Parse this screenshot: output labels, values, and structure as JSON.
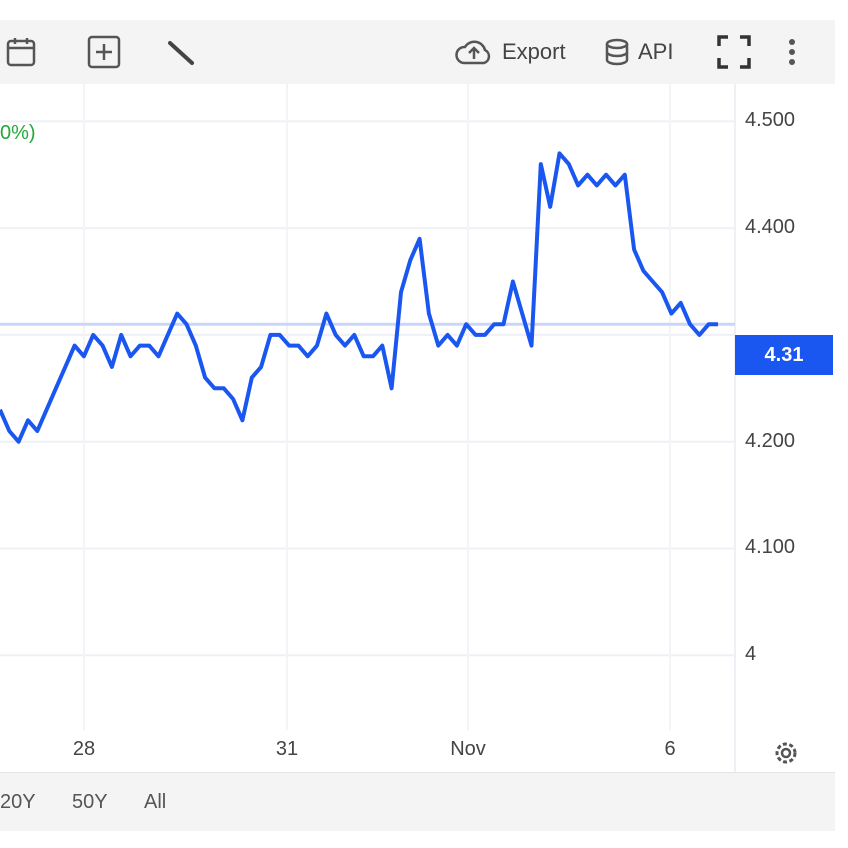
{
  "toolbar": {
    "export_label": "Export",
    "api_label": "API",
    "icons": [
      "calendar-icon",
      "add-indicator-icon",
      "draw-icon",
      "cloud-export-icon",
      "database-api-icon",
      "fullscreen-icon",
      "more-icon"
    ]
  },
  "legend": {
    "change_text": "0%)"
  },
  "last_price_label": "4.31",
  "range_buttons": [
    "20Y",
    "50Y",
    "All"
  ],
  "colors": {
    "line": "#1a56f0",
    "grid": "#eef0f5",
    "accent": "#1a56f0",
    "positive": "#22a83a"
  },
  "chart_data": {
    "type": "line",
    "ylim": [
      3.93,
      4.52
    ],
    "yticks": [
      4,
      4.1,
      4.2,
      4.3,
      4.4,
      4.5
    ],
    "ytick_labels": [
      "4",
      "4.100",
      "4.200",
      "",
      "4.400",
      "4.500"
    ],
    "xtick_labels": [
      "28",
      "31",
      "Nov",
      "6"
    ],
    "last_value": 4.31,
    "grid": true,
    "series": [
      {
        "values": [
          4.23,
          4.21,
          4.2,
          4.22,
          4.21,
          4.23,
          4.25,
          4.27,
          4.29,
          4.28,
          4.3,
          4.29,
          4.27,
          4.3,
          4.28,
          4.29,
          4.29,
          4.28,
          4.3,
          4.32,
          4.31,
          4.29,
          4.26,
          4.25,
          4.25,
          4.24,
          4.22,
          4.26,
          4.27,
          4.3,
          4.3,
          4.29,
          4.29,
          4.28,
          4.29,
          4.32,
          4.3,
          4.29,
          4.3,
          4.28,
          4.28,
          4.29,
          4.25,
          4.34,
          4.37,
          4.39,
          4.32,
          4.29,
          4.3,
          4.29,
          4.31,
          4.3,
          4.3,
          4.31,
          4.31,
          4.35,
          4.32,
          4.29,
          4.46,
          4.42,
          4.47,
          4.46,
          4.44,
          4.45,
          4.44,
          4.45,
          4.44,
          4.45,
          4.38,
          4.36,
          4.35,
          4.34,
          4.32,
          4.33,
          4.31,
          4.3,
          4.31,
          4.31
        ]
      }
    ]
  }
}
